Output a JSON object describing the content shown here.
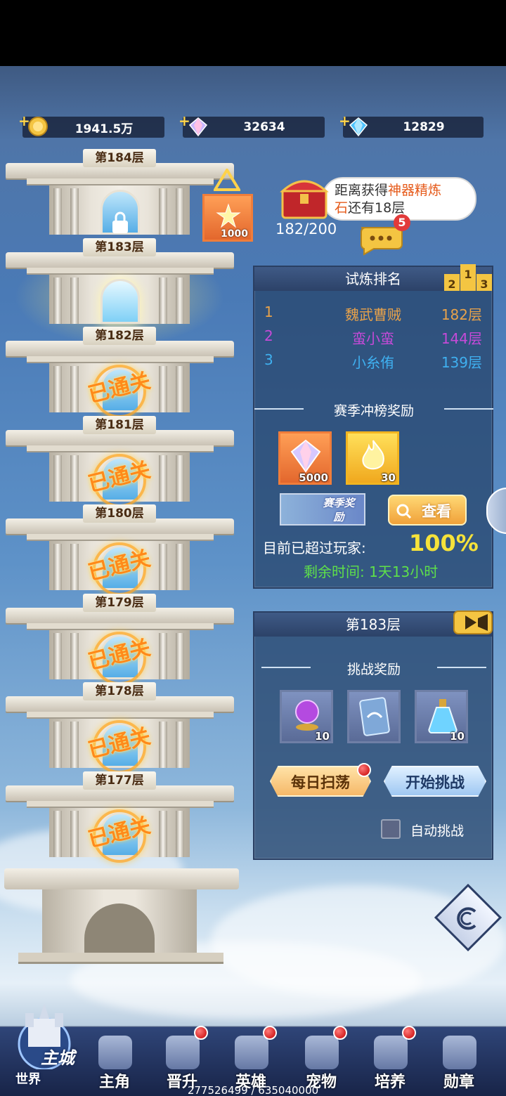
{
  "resources": [
    {
      "value": "1941.5万",
      "icon": "gold-coin-icon"
    },
    {
      "value": "32634",
      "icon": "rainbow-diamond-icon"
    },
    {
      "value": "12829",
      "icon": "blue-diamond-icon"
    }
  ],
  "tower": {
    "floors": [
      {
        "label": "第184层",
        "state": "locked",
        "reward_count": "1000"
      },
      {
        "label": "第183层",
        "state": "current"
      },
      {
        "label": "第182层",
        "state": "cleared",
        "stamp": "已通关"
      },
      {
        "label": "第181层",
        "state": "cleared",
        "stamp": "已通关"
      },
      {
        "label": "第180层",
        "state": "cleared",
        "stamp": "已通关"
      },
      {
        "label": "第179层",
        "state": "cleared",
        "stamp": "已通关"
      },
      {
        "label": "第178层",
        "state": "cleared",
        "stamp": "已通关"
      },
      {
        "label": "第177层",
        "state": "cleared",
        "stamp": "已通关"
      }
    ]
  },
  "chest": {
    "text_a": "距离获得",
    "text_b": "神器精炼",
    "text_c": "石",
    "text_d": "还有18层",
    "progress": "182/200",
    "chat_badge": "5"
  },
  "ranking": {
    "title": "试炼排名",
    "rows": [
      {
        "rank": "1",
        "name": "魏武曹贼",
        "floor": "182层",
        "color": "#e8a24a"
      },
      {
        "rank": "2",
        "name": "蛮小蛮",
        "floor": "144层",
        "color": "#c64ad8"
      },
      {
        "rank": "3",
        "name": "小糸侑",
        "floor": "139层",
        "color": "#3fb0f0"
      }
    ],
    "season_title": "赛季冲榜奖励",
    "rewards": [
      {
        "count": "5000",
        "icon": "rainbow-diamond-icon"
      },
      {
        "count": "30",
        "icon": "fire-essence-icon"
      }
    ],
    "season_badge": "赛季奖励",
    "view_label": "查看",
    "surpass_label": "目前已超过玩家:",
    "surpass_value": "100%",
    "remaining": "剩余时间: 1天13小时"
  },
  "challenge": {
    "title": "第183层",
    "reward_title": "挑战奖励",
    "rewards": [
      {
        "count": "10",
        "icon": "purple-orb-icon"
      },
      {
        "count": "",
        "icon": "blue-card-icon"
      },
      {
        "count": "10",
        "icon": "potion-icon"
      }
    ],
    "sweep_label": "每日扫荡",
    "start_label": "开始挑战",
    "auto_label": "自动挑战"
  },
  "nav": {
    "home_main": "主城",
    "home_world": "世界",
    "items": [
      "主角",
      "晋升",
      "英雄",
      "宠物",
      "培养",
      "勋章"
    ]
  },
  "footer": "277526499 / 635040000"
}
